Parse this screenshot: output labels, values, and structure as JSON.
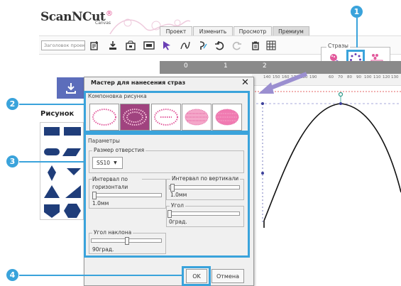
{
  "logo": {
    "brand": "ScanNCut",
    "sub": "Canvas"
  },
  "tabs": [
    "Проект",
    "Изменить",
    "Просмотр",
    "Премиум"
  ],
  "toolbar": {
    "title_placeholder": "Заголовок проек"
  },
  "rhinestones_group": {
    "legend": "Стразы"
  },
  "callouts": [
    "1",
    "2",
    "3",
    "4"
  ],
  "ruler": {
    "ticks": [
      "0",
      "1",
      "2"
    ]
  },
  "ruler2": {
    "ticks": [
      "60",
      "70",
      "80",
      "90",
      "100",
      "110",
      "120",
      "130",
      "140",
      "150",
      "160",
      "170",
      "180",
      "190"
    ]
  },
  "left_panel": {
    "shapes_label": "Рисунок"
  },
  "dialog": {
    "title": "Мастер для нанесения страз",
    "layout_group": "Компоновка рисунка",
    "params_group": "Параметры",
    "hole_size_label": "Размер отверстия",
    "hole_size_value": "SS10",
    "h_interval_label": "Интервал по горизонтали",
    "h_interval_value": "1.0мм",
    "v_interval_label": "Интервал по вертикали",
    "v_interval_value": "1.0мм",
    "angle_label": "Угол",
    "angle_value": "0град.",
    "tilt_label": "Угол наклона",
    "tilt_value": "90град.",
    "ok_label": "OK",
    "cancel_label": "Отмена"
  },
  "colors": {
    "accent": "#3aa3db",
    "selected_layout": "#a0437f",
    "rhinestone": "#e25a9c",
    "blue_button": "#5c6dbb",
    "shape_fill": "#1f3d7a",
    "arrow": "#9b8fd0"
  }
}
